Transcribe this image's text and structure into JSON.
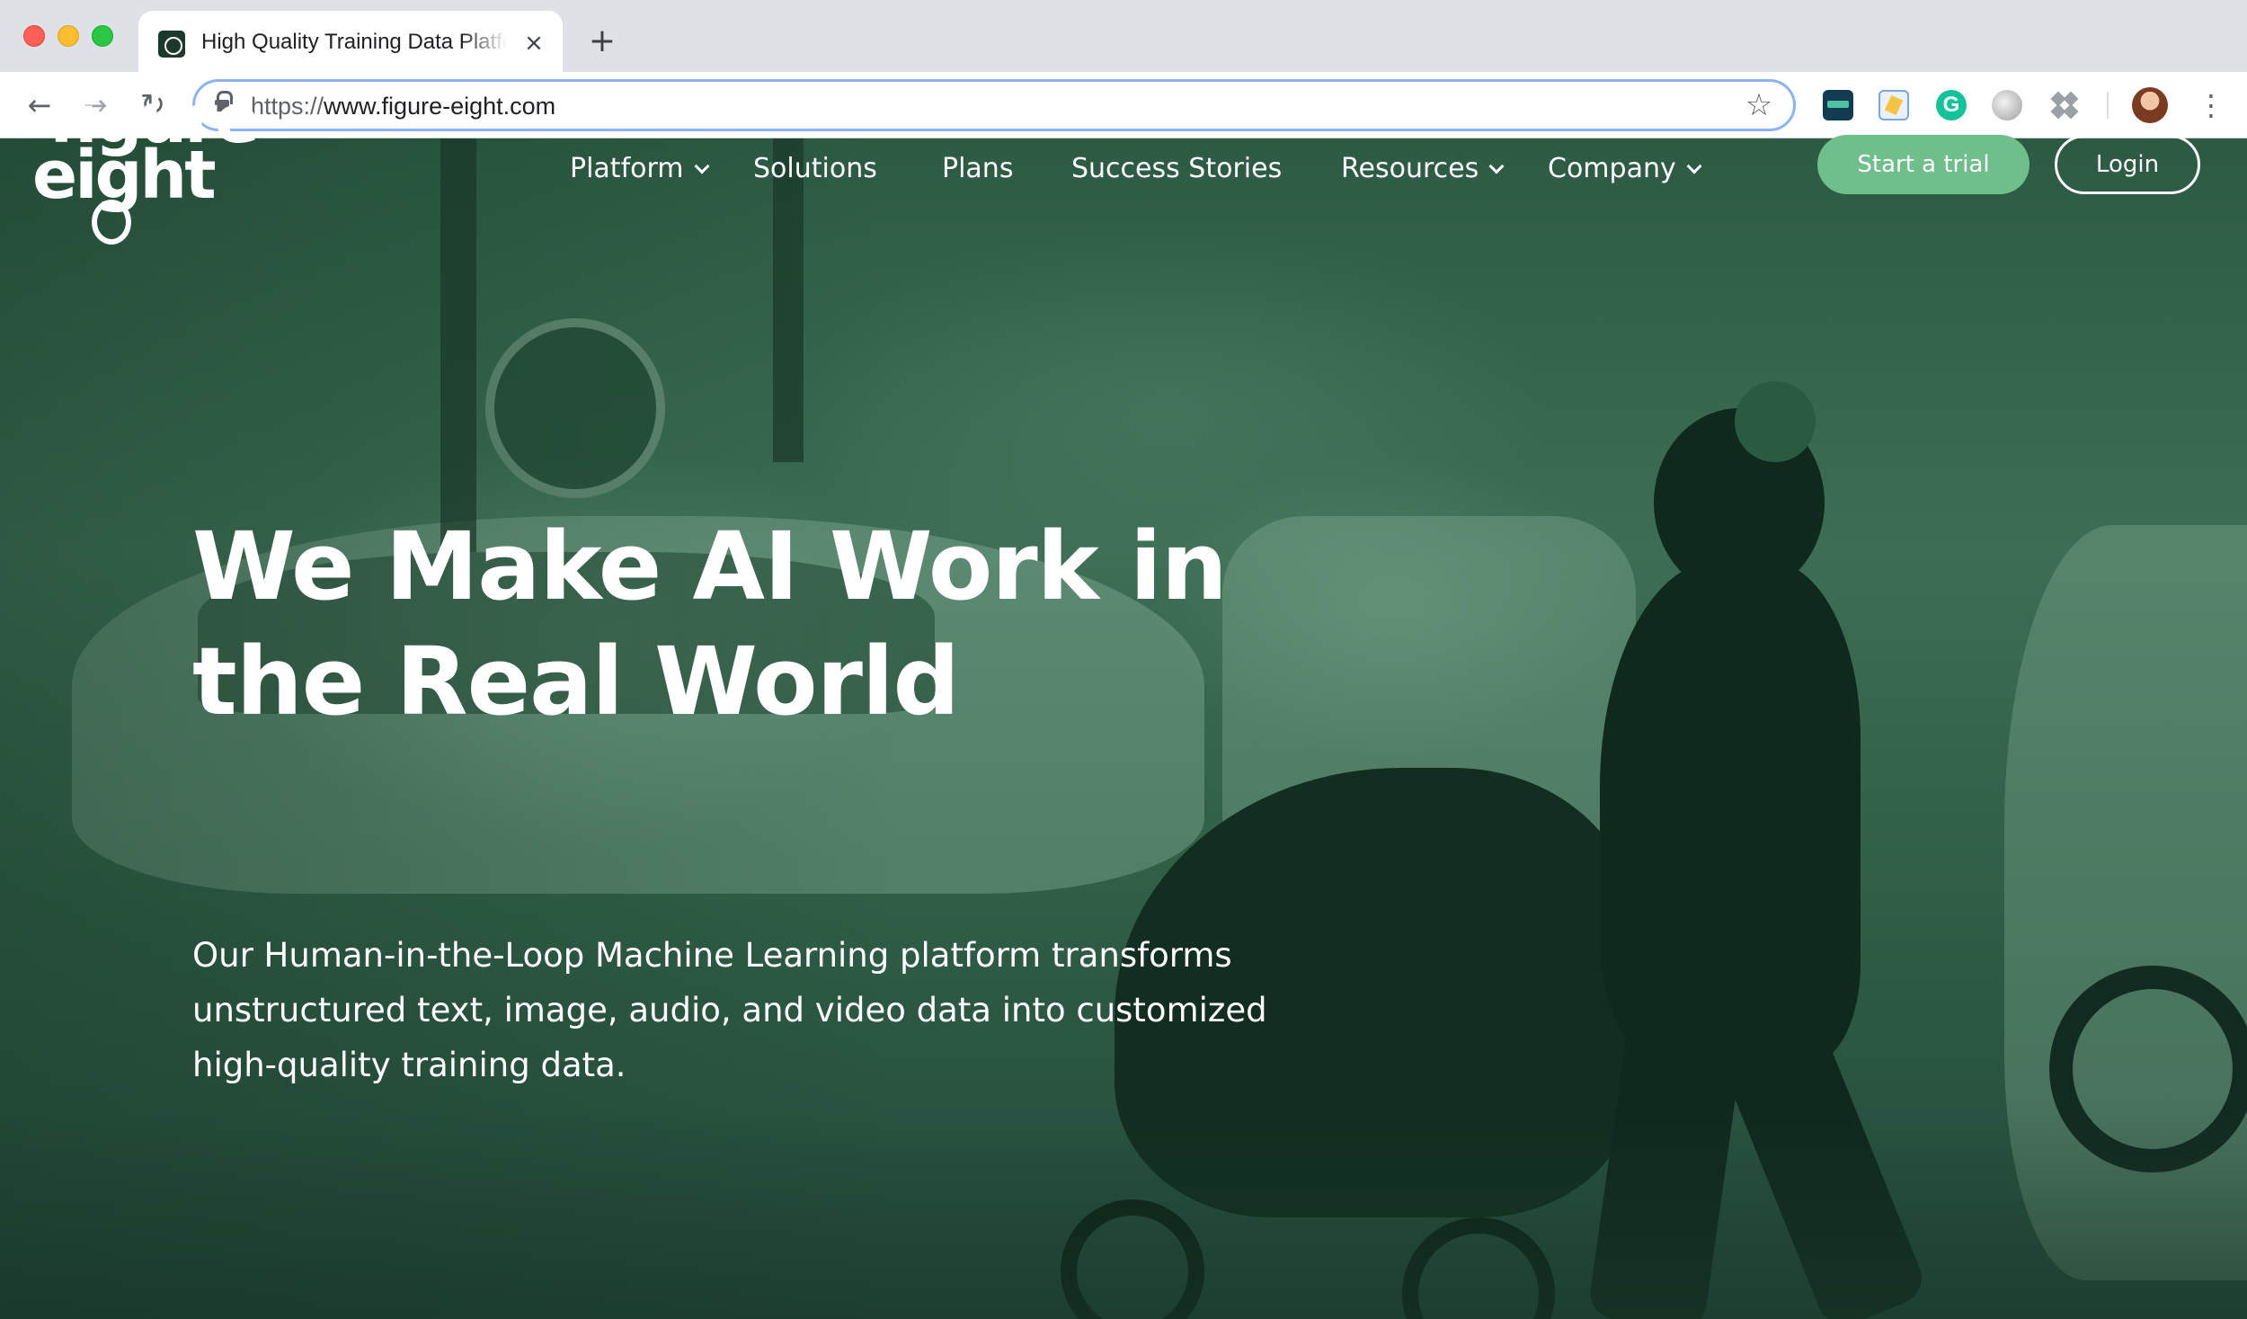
{
  "browser": {
    "tab_title": "High Quality Training Data Platform",
    "tab_close": "×",
    "new_tab": "+",
    "url_scheme": "https://",
    "url_host": "www.figure-eight.com"
  },
  "icons": {
    "back": "arrow-left-icon",
    "forward": "arrow-right-icon",
    "reload": "reload-icon",
    "lock": "lock-icon",
    "star": "star-icon",
    "menu": "vertical-dots-icon",
    "extension_grammarly_letter": "G"
  },
  "site": {
    "logo": {
      "line1": "figure",
      "line2": "eight"
    },
    "nav": {
      "platform": "Platform",
      "solutions": "Solutions",
      "plans": "Plans",
      "success_stories": "Success Stories",
      "resources": "Resources",
      "company": "Company"
    },
    "cta_trial": "Start a trial",
    "cta_login": "Login"
  },
  "hero": {
    "headline_line1": "We Make AI Work in",
    "headline_line2": "the Real World",
    "subtext": "Our Human-in-the-Loop Machine Learning platform transforms unstructured text, image, audio, and video data into customized high-quality training data."
  },
  "colors": {
    "accent_green": "#6fbf8b",
    "hero_overlay": "#2c5a43",
    "omnibox_focus": "#8ab4f8"
  }
}
